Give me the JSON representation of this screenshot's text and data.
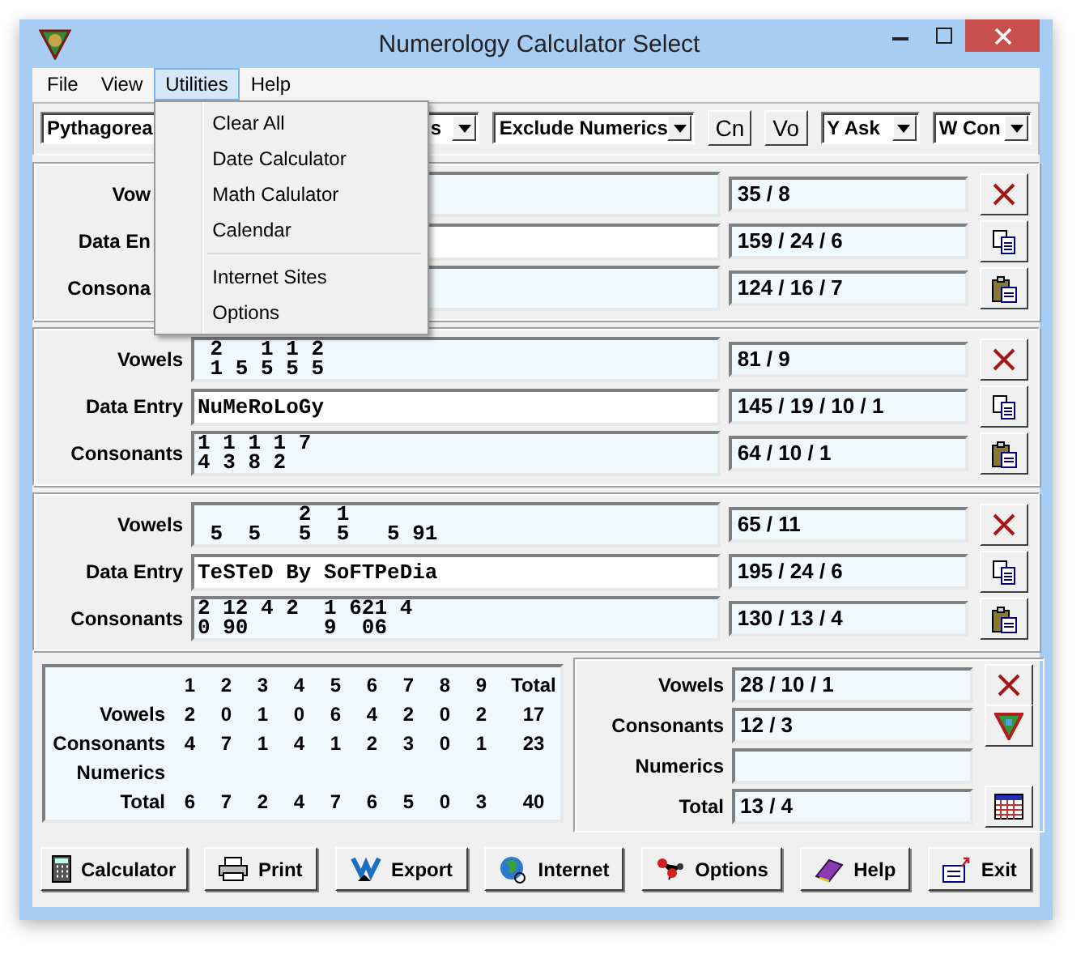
{
  "window": {
    "title": "Numerology Calculator Select"
  },
  "menu": [
    {
      "label": "File",
      "selected": false
    },
    {
      "label": "View",
      "selected": false
    },
    {
      "label": "Utilities",
      "selected": true
    },
    {
      "label": "Help",
      "selected": false
    }
  ],
  "open_menu": [
    {
      "kind": "item",
      "label": "Clear All"
    },
    {
      "kind": "item",
      "label": "Date Calculator"
    },
    {
      "kind": "item",
      "label": "Math Calulator"
    },
    {
      "kind": "item",
      "label": "Calendar"
    },
    {
      "kind": "separator"
    },
    {
      "kind": "item",
      "label": "Internet Sites"
    },
    {
      "kind": "item",
      "label": "Options"
    }
  ],
  "toolbar": [
    {
      "kind": "combo",
      "value": "Pythagorea"
    },
    {
      "kind": "combo",
      "value": "s"
    },
    {
      "kind": "combo",
      "value": "Exclude Numerics"
    },
    {
      "kind": "button",
      "label": "Cn"
    },
    {
      "kind": "button",
      "label": "Vo"
    },
    {
      "kind": "combo",
      "value": "Y Ask"
    },
    {
      "kind": "combo",
      "value": "W Con"
    }
  ],
  "panels": [
    {
      "covered": true,
      "rows": [
        {
          "kind": "vowels",
          "label": "Vow",
          "lines": [],
          "result": "35 / 8"
        },
        {
          "kind": "entry",
          "label": "Data En",
          "lines": [],
          "result": "159 / 24 / 6"
        },
        {
          "kind": "consonants",
          "label": "Consona",
          "lines": [],
          "result": "124 / 16 / 7"
        }
      ]
    },
    {
      "covered": false,
      "rows": [
        {
          "kind": "vowels",
          "label": "Vowels",
          "lines": [
            " 2   1 1 2",
            " 1 5 5 5 5"
          ],
          "result": "81 / 9"
        },
        {
          "kind": "entry",
          "label": "Data Entry",
          "lines": [
            "NuMeRoLoGy"
          ],
          "result": "145 / 19 / 10 / 1"
        },
        {
          "kind": "consonants",
          "label": "Consonants",
          "lines": [
            "1 1 1 1 7",
            "4 3 8 2"
          ],
          "result": "64 / 10 / 1"
        }
      ]
    },
    {
      "covered": false,
      "rows": [
        {
          "kind": "vowels",
          "label": "Vowels",
          "lines": [
            "        2  1",
            " 5  5   5  5   5 91"
          ],
          "result": "65 / 11"
        },
        {
          "kind": "entry",
          "label": "Data Entry",
          "lines": [
            "TeSTeD By SoFTPeDia"
          ],
          "result": "195 / 24 / 6"
        },
        {
          "kind": "consonants",
          "label": "Consonants",
          "lines": [
            "2 12 4 2  1 621 4",
            "0 90      9  06"
          ],
          "result": "130 / 13 / 4"
        }
      ]
    }
  ],
  "grid": {
    "header": [
      "1",
      "2",
      "3",
      "4",
      "5",
      "6",
      "7",
      "8",
      "9",
      "Total"
    ],
    "rows": [
      {
        "label": "Vowels",
        "cells": [
          "2",
          "0",
          "1",
          "0",
          "6",
          "4",
          "2",
          "0",
          "2",
          "17"
        ]
      },
      {
        "label": "Consonants",
        "cells": [
          "4",
          "7",
          "1",
          "4",
          "1",
          "2",
          "3",
          "0",
          "1",
          "23"
        ]
      },
      {
        "label": "Numerics",
        "cells": []
      },
      {
        "label": "Total",
        "cells": [
          "6",
          "7",
          "2",
          "4",
          "7",
          "6",
          "5",
          "0",
          "3",
          "40"
        ]
      }
    ]
  },
  "summary": [
    {
      "label": "Vowels",
      "value": "28 / 10 / 1",
      "kind": "clear"
    },
    {
      "label": "Consonants",
      "value": "12 / 3",
      "kind": "triangle"
    },
    {
      "label": "Numerics",
      "kind": "none"
    },
    {
      "label": "Total",
      "value": "13 / 4",
      "kind": "calendar"
    }
  ],
  "buttons": [
    {
      "kind": "calculator",
      "label": "Calculator"
    },
    {
      "kind": "print",
      "label": "Print"
    },
    {
      "kind": "export",
      "label": "Export"
    },
    {
      "kind": "internet",
      "label": "Internet"
    },
    {
      "kind": "options",
      "label": "Options"
    },
    {
      "kind": "help",
      "label": "Help"
    },
    {
      "kind": "exit",
      "label": "Exit"
    }
  ]
}
